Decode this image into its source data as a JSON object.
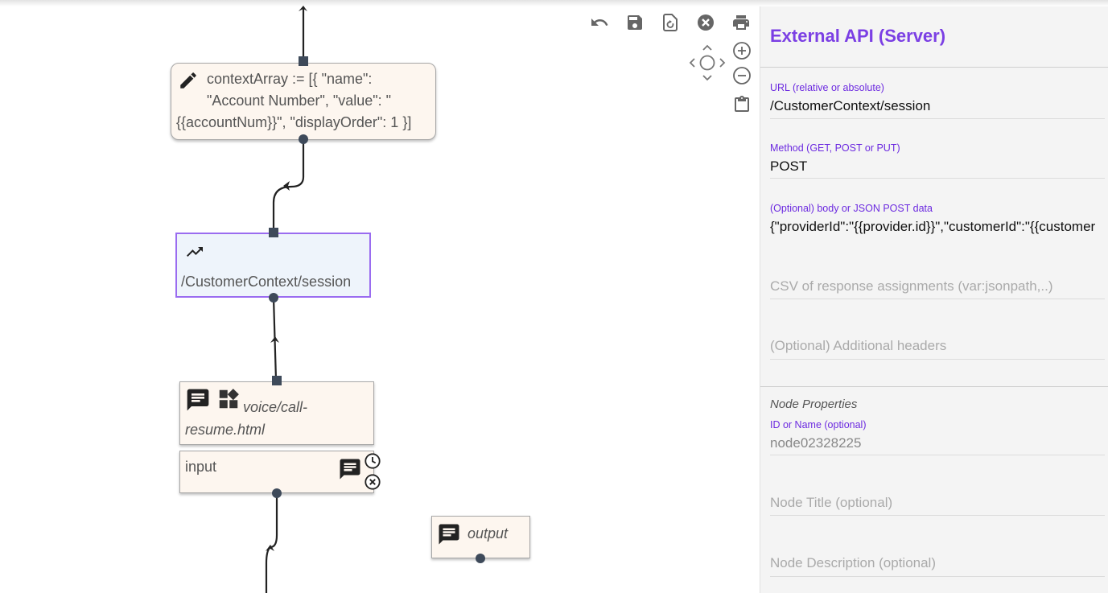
{
  "toolbar": {
    "undo_icon": "undo-icon",
    "save_icon": "save-icon",
    "reload_icon": "reload-icon",
    "close_icon": "close-icon",
    "print_icon": "print-icon",
    "navigate_icon": "pan-navigate-icon",
    "zoom_in_icon": "zoom-in-icon",
    "zoom_out_icon": "zoom-out-icon",
    "clipboard_icon": "clipboard-icon"
  },
  "nodes": {
    "assign": {
      "icon": "pencil-icon",
      "line1": "contextArray := [{ \"name\":",
      "line2": "\"Account Number\", \"value\": \"",
      "line3": "{{accountNum}}\", \"displayOrder\": 1 }]"
    },
    "api": {
      "icon": "trending-up-icon",
      "label": "/CustomerContext/session"
    },
    "page": {
      "icons": [
        "message-icon",
        "widgets-icon"
      ],
      "line1": "voice/call-",
      "line2": "resume.html"
    },
    "input": {
      "label": "input",
      "icons": [
        "message-icon",
        "clock-icon",
        "close-circle-icon"
      ]
    },
    "output": {
      "icon": "message-icon",
      "label": "output"
    }
  },
  "panel": {
    "title": "External API (Server)",
    "fields": [
      {
        "label": "URL (relative or absolute)",
        "value": "/CustomerContext/session"
      },
      {
        "label": "Method (GET, POST or PUT)",
        "value": "POST"
      },
      {
        "label": "(Optional) body or JSON POST data",
        "value": "{\"providerId\":\"{{provider.id}}\",\"customerId\":\"{{customer"
      }
    ],
    "placeholders": {
      "response_assignments": "CSV of response assignments (var:jsonpath,..)",
      "additional_headers": "(Optional) Additional headers"
    },
    "node_properties": {
      "section_title": "Node Properties",
      "id_label": "ID or Name (optional)",
      "id_value": "node02328225",
      "title_placeholder": "Node Title (optional)",
      "description_placeholder": "Node Description (optional)"
    }
  },
  "colors": {
    "accent": "#7b3fe4",
    "node_fill": "#fdf6ef",
    "selected_fill": "#eef4fb",
    "selected_border": "#9a6cf0",
    "port": "#3e4a5a"
  }
}
